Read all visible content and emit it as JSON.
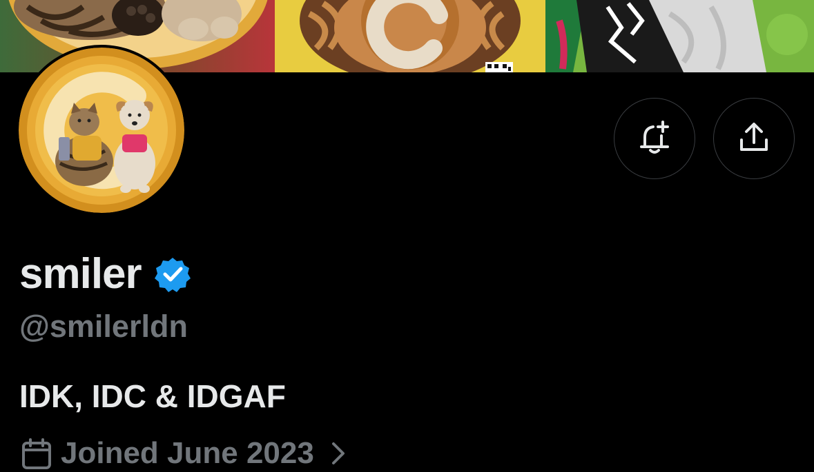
{
  "profile": {
    "display_name": "smiler",
    "handle": "@smilerldn",
    "bio": "IDK, IDC & IDGAF",
    "joined": "Joined June 2023",
    "verified": true
  },
  "icons": {
    "verified": "verified-badge-icon",
    "notify": "bell-plus-icon",
    "share": "share-icon",
    "calendar": "calendar-icon",
    "chevron": "chevron-right-icon"
  },
  "colors": {
    "background": "#000000",
    "primary_text": "#e7e9ea",
    "secondary_text": "#71767b",
    "verified_blue": "#1d9bf0",
    "button_border": "#3a3d41",
    "avatar_gold": "#e3a72f"
  }
}
